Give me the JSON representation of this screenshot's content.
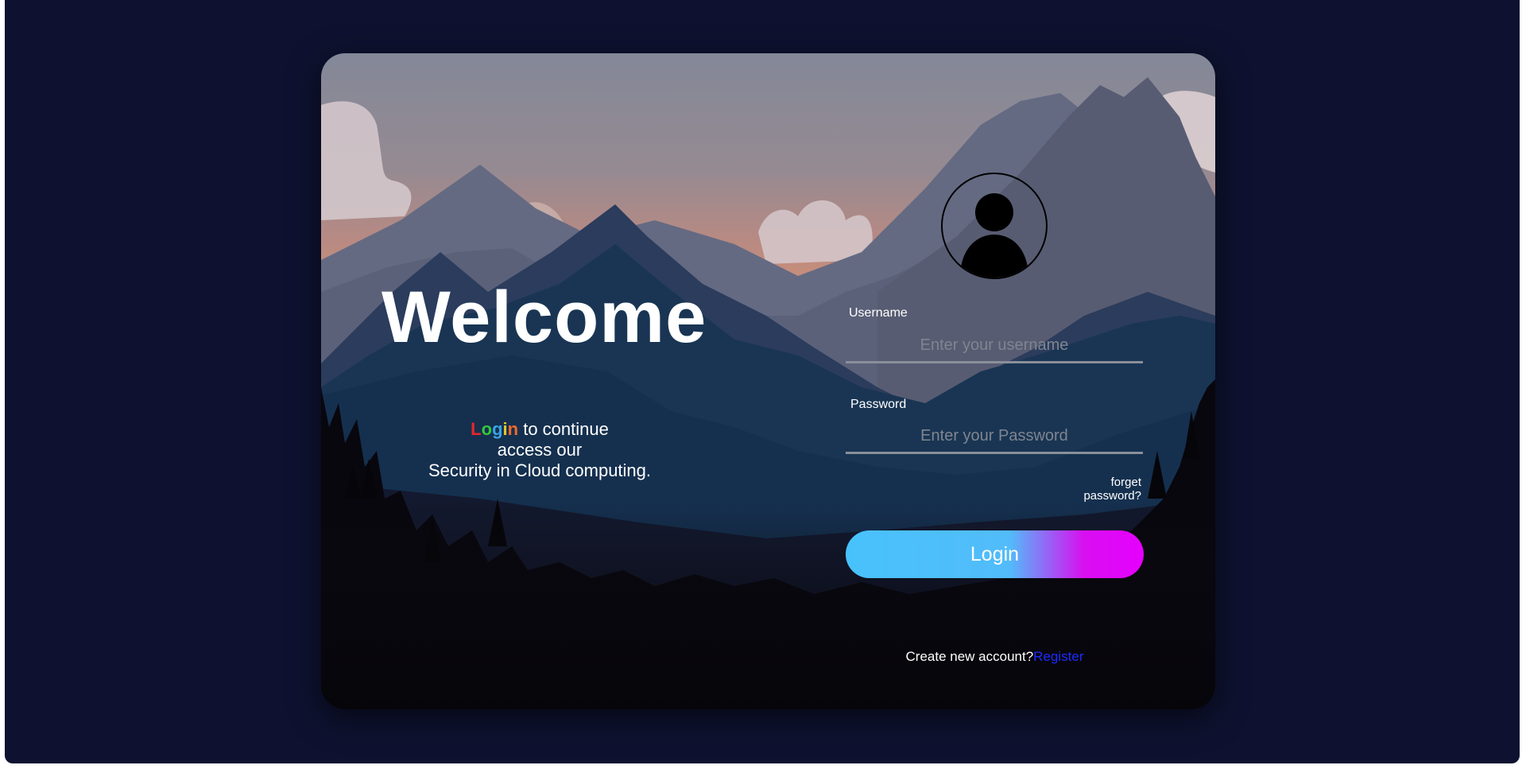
{
  "hero": {
    "title": "Welcome",
    "tagline": {
      "highlight_letters": [
        "L",
        "o",
        "g",
        "i",
        "n"
      ],
      "highlight_colors": [
        "#e8262a",
        "#33c93a",
        "#3aa3e6",
        "#e6c72a",
        "#f06a2a"
      ],
      "line1_rest": " to continue",
      "line2": "access our",
      "line3": "Security in Cloud computing."
    }
  },
  "form": {
    "avatar_icon": "user-avatar-icon",
    "username": {
      "label": "Username",
      "placeholder": "Enter your username"
    },
    "password": {
      "label": "Password",
      "placeholder": "Enter your Password"
    },
    "forgot_label": "forget password?",
    "login_label": "Login",
    "create_text": "Create new account?",
    "register_label": "Register"
  },
  "colors": {
    "page_background": "#0e1230",
    "button_gradient_start": "#48c2fb",
    "button_gradient_end": "#e600ff",
    "register_link": "#1a2bff"
  }
}
